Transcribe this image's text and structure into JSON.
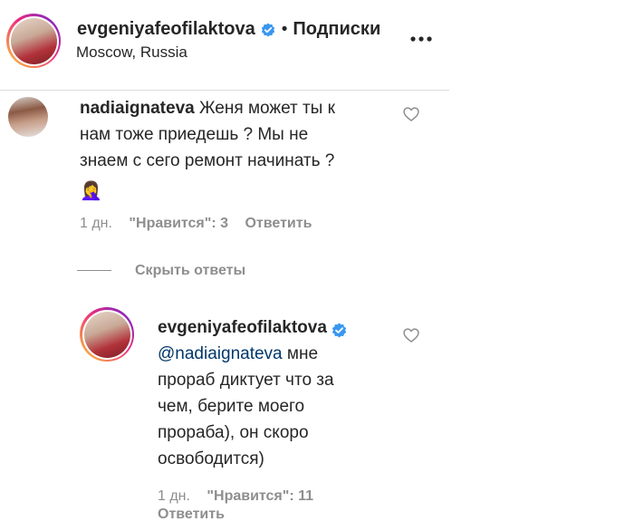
{
  "header": {
    "username": "evgeniyafeofilaktova",
    "separator": "•",
    "follow_label": "Подписки",
    "location": "Moscow, Russia",
    "more_label": "•••"
  },
  "comment1": {
    "username": "nadiaignateva",
    "text": "Женя может ты к нам тоже приедешь ? Мы не знаем с сего ремонт начинать ?",
    "line1": "Женя может ты к",
    "line2": "нам тоже приедешь ? Мы не",
    "line3": "знаем с сего ремонт начинать ?",
    "emoji": "🤦‍♀️",
    "time": "1 дн.",
    "likes": "\"Нравится\": 3",
    "reply_label": "Ответить"
  },
  "replies_toggle": {
    "label": "Скрыть ответы"
  },
  "reply1": {
    "username": "evgeniyafeofilaktova",
    "mention": "@nadiaignateva",
    "line1_rest": " мне",
    "line2": "прораб диктует что за",
    "line3": "чем, берите моего",
    "line4": "прораба), он скоро",
    "line5": "освободится)",
    "time": "1 дн.",
    "likes": "\"Нравится\": 11",
    "reply_label": "Ответить"
  },
  "colors": {
    "verified": "#3897f0",
    "text": "#262626",
    "muted": "#8e8e8e",
    "mention": "#00376b"
  },
  "icons": [
    "verified-badge-icon",
    "more-options-icon",
    "heart-icon"
  ]
}
